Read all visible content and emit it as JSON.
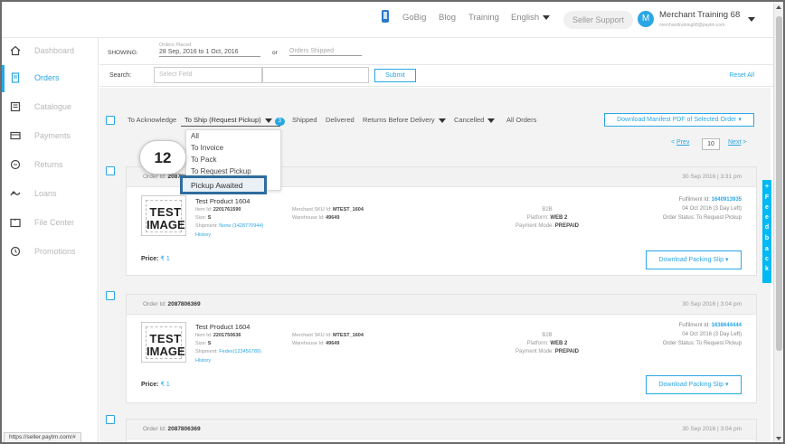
{
  "topbar": {
    "nav": [
      "GoBig",
      "Blog",
      "Training",
      "English"
    ],
    "seller_support": "Seller Support",
    "avatar_initial": "M",
    "merchant_name": "Merchant Training 68",
    "merchant_email": "merchanttraining68@paytm.com"
  },
  "sidebar": {
    "items": [
      {
        "label": "Dashboard",
        "icon": "home-icon"
      },
      {
        "label": "Orders",
        "icon": "orders-icon"
      },
      {
        "label": "Catalogue",
        "icon": "catalogue-icon"
      },
      {
        "label": "Payments",
        "icon": "payments-icon"
      },
      {
        "label": "Returns",
        "icon": "returns-icon"
      },
      {
        "label": "Loans",
        "icon": "loans-icon"
      },
      {
        "label": "File Center",
        "icon": "file-center-icon"
      },
      {
        "label": "Promotions",
        "icon": "promotions-icon"
      }
    ],
    "active_index": 1
  },
  "filters": {
    "showing_label": "SHOWING:",
    "orders_placed_label": "Orders Placed",
    "orders_placed_value": "28 Sep, 2016 to 1 Oct, 2016",
    "or_label": "or",
    "orders_shipped_label": "Orders Shipped",
    "search_label": "Search:",
    "search_placeholder": "Select Field",
    "submit_label": "Submit",
    "reset_label": "Reset All"
  },
  "status_tabs": {
    "items": [
      "To Acknowledge",
      "To Ship (Request Pickup)",
      "Shipped",
      "Delivered",
      "Returns Before Delivery",
      "Cancelled",
      "All Orders"
    ],
    "to_ship_count": "3",
    "download_label": "Download Manifest PDF of Selected Order"
  },
  "dropdown": {
    "items": [
      "All",
      "To Invoice",
      "To Pack",
      "To Request Pickup",
      "Pickup Awaited"
    ]
  },
  "step_number": "12",
  "pagination": {
    "prev": "Prev",
    "page": "10",
    "next": "Next"
  },
  "accent_color": "#2aa7e4",
  "orders": [
    {
      "order_id_label": "Order Id:",
      "order_id": "2087806369",
      "date": "30 Sep 2016 | 3:31 pm",
      "thumb_line1": "TEST",
      "thumb_line2": "IMAGE",
      "product": "Test Product 1604",
      "item_id_label": "Item Id:",
      "item_id": "2201761590",
      "size_label": "Size:",
      "size": "S",
      "shipment_label": "Shipment:",
      "shipment": "None (1428770944)",
      "history_label": "History",
      "sku_label": "Merchant SKU Id:",
      "sku": "MTEST_1604",
      "warehouse_label": "Warehouse Id:",
      "warehouse": "49649",
      "delivery_type": "B2B",
      "platform_label": "Platform:",
      "platform": "WEB 2",
      "payment_label": "Payment Mode:",
      "payment": "PREPAID",
      "fulfilment_label": "Fulfilment Id:",
      "fulfilment": "1640913935",
      "due": "04 Oct 2016 (3 Day Left)",
      "status_text": "Order Status: To Request Pickup",
      "price_label": "Price:",
      "price": "₹ 1",
      "download_label": "Download Packing Slip ▾"
    },
    {
      "order_id_label": "Order Id:",
      "order_id": "2087806369",
      "date": "30 Sep 2016 | 3:04 pm",
      "thumb_line1": "TEST",
      "thumb_line2": "IMAGE",
      "product": "Test Product 1604",
      "item_id_label": "Item Id:",
      "item_id": "2201750636",
      "size_label": "Size:",
      "size": "S",
      "shipment_label": "Shipment:",
      "shipment": "Fedex(123456789)",
      "history_label": "History",
      "sku_label": "Merchant SKU Id:",
      "sku": "MTEST_1604",
      "warehouse_label": "Warehouse Id:",
      "warehouse": "49649",
      "delivery_type": "B2B",
      "platform_label": "Platform:",
      "platform": "WEB 2",
      "payment_label": "Payment Mode:",
      "payment": "PREPAID",
      "fulfilment_label": "Fulfilment Id:",
      "fulfilment": "1638644444",
      "due": "04 Oct 2016 (3 Day Left)",
      "status_text": "Order Status: To Request Pickup",
      "price_label": "Price:",
      "price": "₹ 1",
      "download_label": "Download Packing Slip ▾"
    },
    {
      "order_id_label": "Order Id:",
      "order_id": "2087806369",
      "date": "30 Sep 2016 | 3:04 pm"
    }
  ],
  "feedback_letters": [
    "F",
    "e",
    "e",
    "d",
    "b",
    "a",
    "c",
    "k"
  ],
  "status_url": "https://seller.paytm.com/#"
}
